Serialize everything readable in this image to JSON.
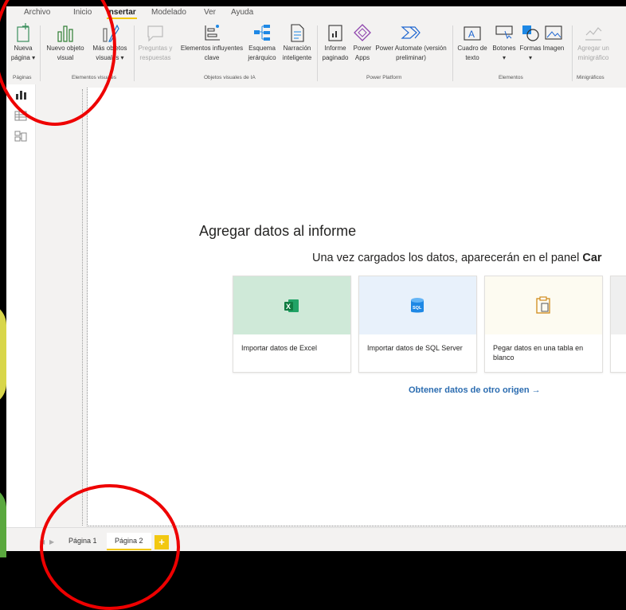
{
  "menu": {
    "items": [
      "Archivo",
      "Inicio",
      "Insertar",
      "Modelado",
      "Ver",
      "Ayuda"
    ],
    "active": "Insertar"
  },
  "ribbon": {
    "new_page": [
      "Nueva",
      "página ▾"
    ],
    "new_visual": [
      "Nuevo objeto",
      "visual"
    ],
    "more_visuals": [
      "Más objetos",
      "visuales ▾"
    ],
    "qa": [
      "Preguntas y",
      "respuestas"
    ],
    "key_influencers": [
      "Elementos influyentes",
      "clave"
    ],
    "decomposition": [
      "Esquema",
      "jerárquico"
    ],
    "narrative": [
      "Narración",
      "inteligente"
    ],
    "paginated": [
      "Informe",
      "paginado"
    ],
    "power_apps": [
      "Power",
      "Apps"
    ],
    "power_automate": [
      "Power Automate (versión",
      "preliminar)"
    ],
    "text_box": [
      "Cuadro de",
      "texto"
    ],
    "buttons": [
      "Botones",
      "▾"
    ],
    "shapes": [
      "Formas",
      "▾"
    ],
    "image": [
      "Imagen",
      ""
    ],
    "sparkline": [
      "Agregar un",
      "minigráfico"
    ],
    "groups": {
      "pages": "Páginas",
      "visuals": "Elementos visuales",
      "ai": "Objetos visuales de IA",
      "power_platform": "Power Platform",
      "elements": "Elementos",
      "sparklines": "Minigráficos"
    }
  },
  "canvas": {
    "title": "Agregar datos al informe",
    "subtitle_prefix": "Una vez cargados los datos, aparecerán en el panel ",
    "subtitle_bold": "Car",
    "cards": [
      {
        "label": "Importar datos de Excel",
        "icon": "excel-icon",
        "bg": "#cfe9d8"
      },
      {
        "label": "Importar datos de SQL Server",
        "icon": "sql-icon",
        "bg": "#e8f1fb"
      },
      {
        "label": "Pegar datos en una tabla en blanco",
        "icon": "clipboard-icon",
        "bg": "#fdfbf1"
      }
    ],
    "other_source_link": "Obtener datos de otro origen →"
  },
  "tabs": {
    "items": [
      "Página 1",
      "Página 2"
    ],
    "active": "Página 2",
    "add_label": "+"
  },
  "colors": {
    "accent": "#f2c811",
    "link": "#2b6cb0",
    "annotation": "#e00000"
  }
}
